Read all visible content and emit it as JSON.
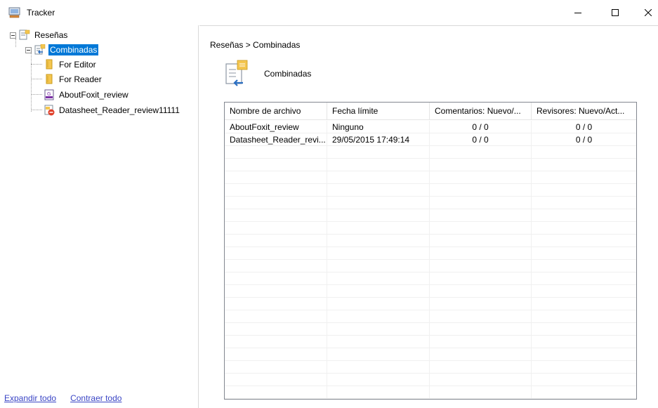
{
  "window": {
    "title": "Tracker",
    "controls": {
      "minimize": "minimize-icon",
      "maximize": "maximize-icon",
      "close": "close-icon"
    }
  },
  "tree": {
    "root": {
      "label": "Reseñas",
      "icon": "reviews-icon"
    },
    "items": [
      {
        "label": "Combinadas",
        "icon": "combined-folder-icon",
        "selected": true
      },
      {
        "label": "For Editor",
        "icon": "folder-icon"
      },
      {
        "label": "For Reader",
        "icon": "folder-icon"
      },
      {
        "label": "AboutFoxit_review",
        "icon": "pdf-file-icon"
      },
      {
        "label": "Datasheet_Reader_review11111",
        "icon": "pdf-error-file-icon"
      }
    ]
  },
  "links": {
    "expand_all": "Expandir todo",
    "collapse_all": "Contraer todo"
  },
  "main": {
    "breadcrumb": "Reseñas > Combinadas",
    "folder_title": "Combinadas",
    "table": {
      "columns": [
        "Nombre de archivo",
        "Fecha límite",
        "Comentarios: Nuevo/...",
        "Revisores: Nuevo/Act..."
      ],
      "rows": [
        [
          "AboutFoxit_review",
          "Ninguno",
          "0 / 0",
          "0 / 0"
        ],
        [
          "Datasheet_Reader_revi...",
          "29/05/2015 17:49:14",
          "0 / 0",
          "0 / 0"
        ]
      ]
    }
  },
  "colors": {
    "selection": "#0078d7",
    "link": "#3a45c5",
    "folder": "#f4c64f"
  }
}
